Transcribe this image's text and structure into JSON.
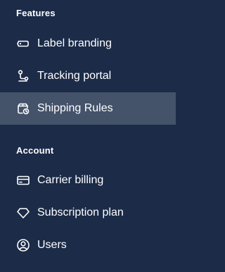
{
  "sections": [
    {
      "heading": "Features",
      "items": [
        {
          "label": "Label branding",
          "icon": "tag-icon"
        },
        {
          "label": "Tracking portal",
          "icon": "route-icon"
        },
        {
          "label": "Shipping Rules",
          "icon": "package-clock-icon",
          "active": true
        }
      ]
    },
    {
      "heading": "Account",
      "items": [
        {
          "label": "Carrier billing",
          "icon": "credit-card-icon"
        },
        {
          "label": "Subscription plan",
          "icon": "diamond-icon"
        },
        {
          "label": "Users",
          "icon": "user-circle-icon"
        }
      ]
    }
  ],
  "colors": {
    "sidebar_bg": "#1b2b48",
    "active_bg": "#44536a",
    "text": "#ffffff"
  }
}
